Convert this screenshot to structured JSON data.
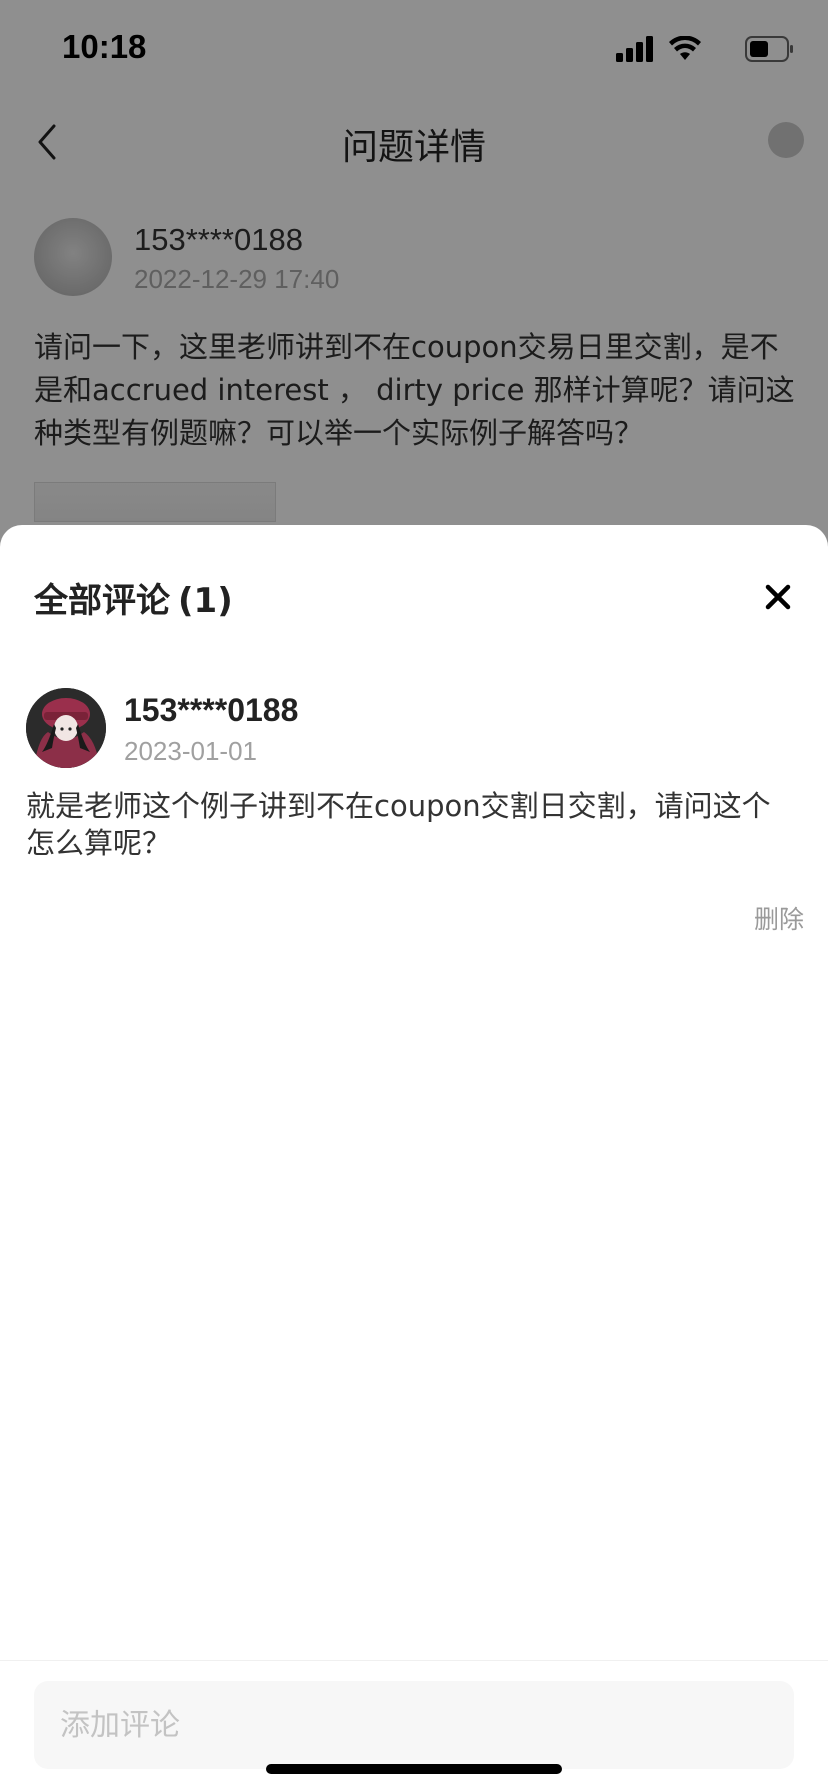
{
  "status_bar": {
    "time": "10:18"
  },
  "nav": {
    "title": "问题详情"
  },
  "question": {
    "author": "153****0188",
    "time": "2022-12-29 17:40",
    "body": "请问一下，这里老师讲到不在coupon交易日里交割，是不是和accrued interest ， dirty price 那样计算呢？请问这种类型有例题嘛？可以举一个实际例子解答吗？"
  },
  "sheet": {
    "title": "全部评论",
    "count": "(1)"
  },
  "comments": [
    {
      "author": "153****0188",
      "date": "2023-01-01",
      "text": "就是老师这个例子讲到不在coupon交割日交割，请问这个怎么算呢？",
      "delete_label": "删除"
    }
  ],
  "input": {
    "placeholder": "添加评论"
  },
  "colors": {
    "overlay": "#000000",
    "sheet_bg": "#ffffff",
    "input_bg": "#f7f7f7",
    "muted_text": "#a0a0a0"
  },
  "icons": {
    "back": "chevron-left-icon",
    "close": "close-icon",
    "signal": "signal-icon",
    "wifi": "wifi-icon",
    "battery": "battery-icon"
  }
}
